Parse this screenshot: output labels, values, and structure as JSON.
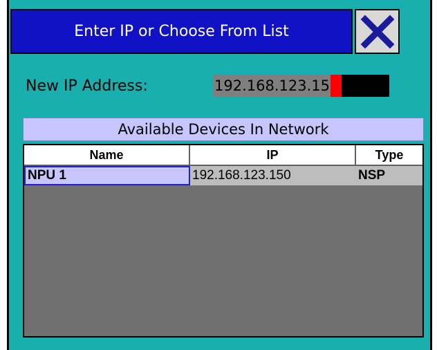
{
  "dialog": {
    "title": "Enter IP or Choose From List",
    "close_icon": "close-x-icon"
  },
  "ip_entry": {
    "label": "New IP Address:",
    "value": "192.168.123.150"
  },
  "devices": {
    "header": "Available Devices In Network",
    "columns": [
      "Name",
      "IP",
      "Type"
    ],
    "rows": [
      {
        "name": "NPU 1",
        "ip": "192.168.123.150",
        "type": "NSP"
      }
    ]
  },
  "colors": {
    "background": "#1aafaf",
    "title_bar": "#1111c6",
    "close_x": "#1a1a9a",
    "header_band": "#c6c6fd",
    "cursor": "#ff0000"
  }
}
